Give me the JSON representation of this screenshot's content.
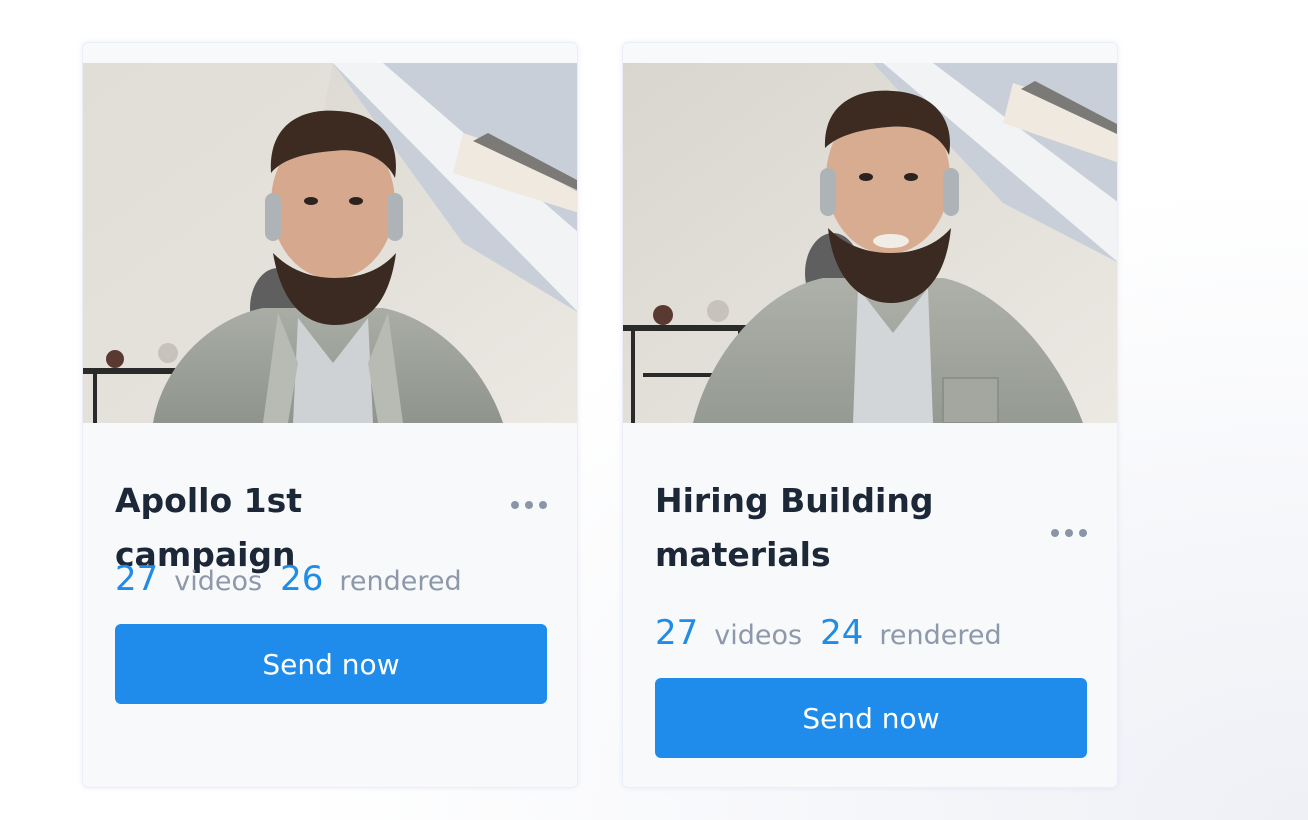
{
  "colors": {
    "accent": "#1f8ceb",
    "title_text": "#1c2737",
    "muted_text": "#8e98ab",
    "card_bg": "#f8f9fa"
  },
  "campaigns": [
    {
      "title": "Apollo 1st campaign",
      "videos_count": "27",
      "videos_label": "videos",
      "rendered_count": "26",
      "rendered_label": "rendered",
      "button_label": "Send now",
      "menu_icon": "more-horizontal-icon"
    },
    {
      "title": "Hiring Building materials",
      "videos_count": "27",
      "videos_label": "videos",
      "rendered_count": "24",
      "rendered_label": "rendered",
      "button_label": "Send now",
      "menu_icon": "more-horizontal-icon"
    }
  ]
}
